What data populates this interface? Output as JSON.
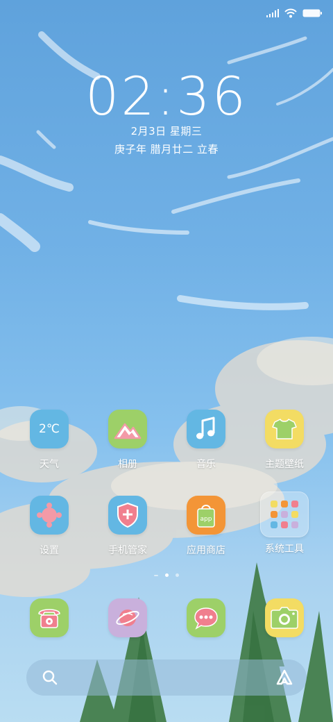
{
  "status": {
    "signal_icon": "signal-icon",
    "wifi_icon": "wifi-icon",
    "battery_icon": "battery-icon"
  },
  "lockscreen": {
    "time": "02:36",
    "date": "2月3日 星期三",
    "lunar": "庚子年 腊月廿二 立春"
  },
  "apps_row1": [
    {
      "label": "天气",
      "icon": "weather-icon",
      "icon_text": "2℃",
      "color": "#63b7e3"
    },
    {
      "label": "相册",
      "icon": "gallery-icon",
      "color": "#9dd068"
    },
    {
      "label": "音乐",
      "icon": "music-icon",
      "color": "#63b7e3"
    },
    {
      "label": "主题壁纸",
      "icon": "tshirt-icon",
      "color": "#f3dc63"
    }
  ],
  "apps_row2": [
    {
      "label": "设置",
      "icon": "settings-icon",
      "color": "#63b7e3"
    },
    {
      "label": "手机管家",
      "icon": "shield-icon",
      "color": "#63b7e3"
    },
    {
      "label": "应用商店",
      "icon": "app-store-icon",
      "icon_text": "app",
      "color": "#f39537"
    },
    {
      "label": "系统工具",
      "icon": "folder-icon"
    }
  ],
  "page_indicator": {
    "pages": 3,
    "active": 1
  },
  "dock": [
    {
      "icon": "phone-icon",
      "color": "#9dd068"
    },
    {
      "icon": "browser-icon",
      "color": "#c9b0dc"
    },
    {
      "icon": "messages-icon",
      "color": "#9dd068"
    },
    {
      "icon": "camera-icon",
      "color": "#f3dc63"
    }
  ],
  "search": {
    "icon": "search-icon",
    "assistant_icon": "assistant-icon"
  }
}
